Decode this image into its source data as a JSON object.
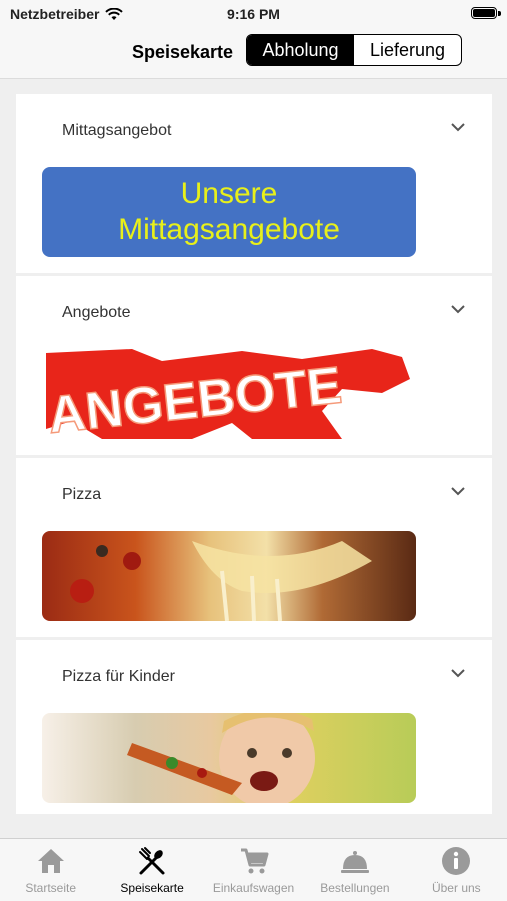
{
  "status_bar": {
    "carrier": "Netzbetreiber",
    "time": "9:16 PM"
  },
  "nav": {
    "title": "Speisekarte",
    "segments": [
      {
        "label": "Abholung",
        "selected": true
      },
      {
        "label": "Lieferung",
        "selected": false
      }
    ]
  },
  "categories": [
    {
      "title": "Mittagsangebot",
      "banner_lines": [
        "Unsere",
        "Mittagsangebote"
      ]
    },
    {
      "title": "Angebote",
      "banner_text": "ANGEBOTE"
    },
    {
      "title": "Pizza"
    },
    {
      "title": "Pizza für Kinder"
    }
  ],
  "tabbar": {
    "tabs": [
      {
        "label": "Startseite",
        "icon": "home-icon",
        "active": false
      },
      {
        "label": "Speisekarte",
        "icon": "fork-spoon-icon",
        "active": true
      },
      {
        "label": "Einkaufswagen",
        "icon": "cart-icon",
        "active": false
      },
      {
        "label": "Bestellungen",
        "icon": "cloche-icon",
        "active": false
      },
      {
        "label": "Über uns",
        "icon": "info-icon",
        "active": false
      }
    ]
  },
  "colors": {
    "accent": "#000000",
    "inactive": "#9a9a9a",
    "banner_blue": "#4472c4",
    "banner_text": "#e8f01a",
    "offer_red": "#e8251a"
  }
}
